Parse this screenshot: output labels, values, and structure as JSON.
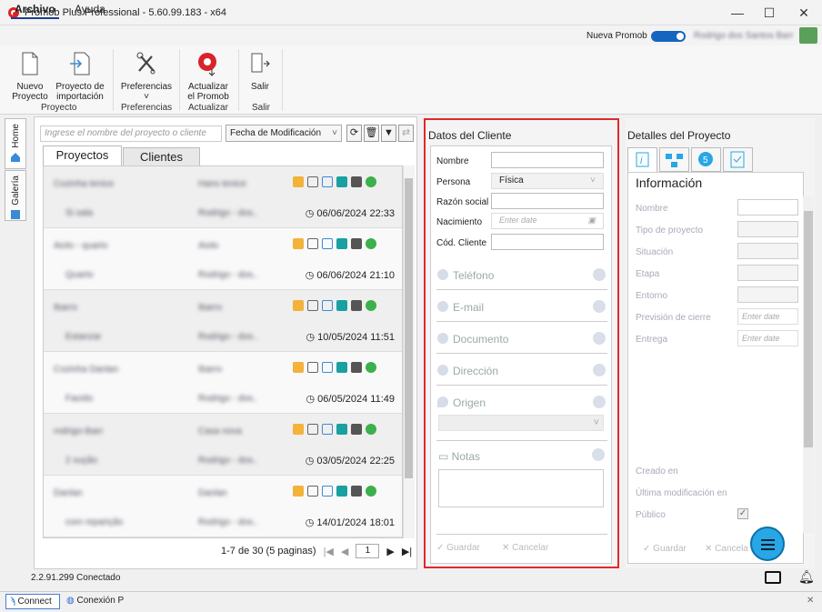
{
  "window": {
    "title": "Promob Plus Professional - 5.60.99.183 - x64",
    "minimize": "—",
    "maximize": "☐",
    "close": "✕"
  },
  "menu": {
    "archivo": "Archivo",
    "ayuda": "Ayuda"
  },
  "header": {
    "nueva_promob": "Nueva Promob",
    "user": "Rodrigo dos Santos Barr"
  },
  "ribbon": {
    "buttons": [
      {
        "label1": "Nuevo",
        "label2": "Proyecto",
        "icon": "new-document-icon"
      },
      {
        "label1": "Proyecto de",
        "label2": "importación",
        "icon": "import-icon"
      },
      {
        "label1": "Preferencias",
        "label2": "˅",
        "icon": "tools-icon"
      },
      {
        "label1": "Actualizar",
        "label2": "el Promob",
        "icon": "update-icon"
      },
      {
        "label1": "Salir",
        "label2": "",
        "icon": "exit-icon"
      }
    ],
    "groups": [
      "Proyecto",
      "Preferencias",
      "Actualizar",
      "Salir"
    ]
  },
  "side_tabs": {
    "home": "Home",
    "galeria": "Galería"
  },
  "projects": {
    "search_placeholder": "Ingrese el nombre del proyecto o cliente",
    "sort": "Fecha de Modificación",
    "tabs": [
      "Proyectos",
      "Clientes"
    ],
    "rows": [
      {
        "name": "Cozinha tenice",
        "user": "Hans tenice",
        "sub": "Si sala",
        "author": "Rodrigo - dos..",
        "date": "06/06/2024 22:33"
      },
      {
        "name": "Aiolo - quarto",
        "user": "Aiolo",
        "sub": "Quarto",
        "author": "Rodrigo - dos..",
        "date": "06/06/2024 21:10"
      },
      {
        "name": "Ibarro",
        "user": "Ibarro",
        "sub": "Estanzar",
        "author": "Rodrigo - dos..",
        "date": "10/05/2024 11:51"
      },
      {
        "name": "Cozinha Danlan",
        "user": "Ibarro",
        "sub": "Facido",
        "author": "Rodrigo - dos..",
        "date": "06/05/2024 11:49"
      },
      {
        "name": "rodrigo-ibarr",
        "user": "Casa nova",
        "sub": "2 sução",
        "author": "Rodrigo - dos..",
        "date": "03/05/2024 22:25"
      },
      {
        "name": "Danlan",
        "user": "Danlan",
        "sub": "com reparição",
        "author": "Rodrigo - dos..",
        "date": "14/01/2024 18:01"
      }
    ],
    "pager_text": "1-7 de 30 (5 paginas)",
    "page": "1"
  },
  "client": {
    "title": "Datos del Cliente",
    "fields": {
      "nombre": "Nombre",
      "persona": "Persona",
      "persona_value": "Física",
      "razon": "Razón social",
      "nacimiento": "Nacimiento",
      "date_placeholder": "Enter date",
      "cod": "Cód. Cliente"
    },
    "sections": [
      "Teléfono",
      "E-mail",
      "Documento",
      "Dirección",
      "Origen"
    ],
    "notas": "Notas",
    "guardar": "Guardar",
    "cancelar": "Cancelar"
  },
  "details": {
    "title": "Detalles del Proyecto",
    "info": "Información",
    "labels": [
      "Nombre",
      "Tipo de proyecto",
      "Situación",
      "Etapa",
      "Entorno",
      "Previsión de cierre",
      "Entrega"
    ],
    "date_placeholder": "Enter date",
    "creado": "Creado en",
    "ultima": "Última modificación en",
    "publico": "Público",
    "guardar": "Guardar",
    "cancelar": "Cancela"
  },
  "status": {
    "connection": "2.2.91.299  Conectado",
    "connect_btn": "Connect",
    "conexion": "Conexión P"
  }
}
